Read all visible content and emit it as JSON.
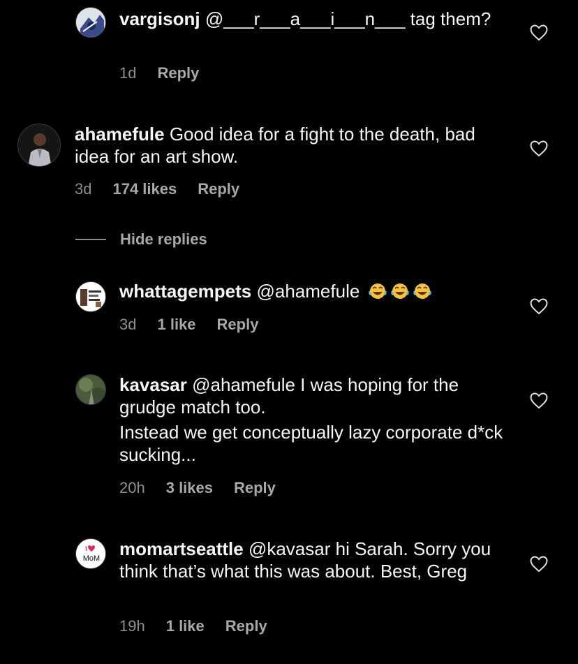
{
  "comments": [
    {
      "username": "vargisonj",
      "text": " @___r___a___i___n___ tag them?",
      "time": "1d",
      "likes": "",
      "reply_label": "Reply",
      "avatar_icon": "photo-avatar"
    },
    {
      "username": "ahamefule",
      "text": " Good idea for a fight to the death, bad idea for an art show.",
      "time": "3d",
      "likes": "174 likes",
      "reply_label": "Reply",
      "avatar_icon": "photo-avatar"
    },
    {
      "username": "whattagempets",
      "text": " @ahamefule ",
      "time": "3d",
      "likes": "1 like",
      "reply_label": "Reply",
      "avatar_icon": "logo-avatar",
      "emoji": [
        "tears-of-joy-emoji",
        "tears-of-joy-emoji",
        "tears-of-joy-emoji"
      ]
    },
    {
      "username": "kavasar",
      "text": " @ahamefule I was hoping for the grudge match too.",
      "text2": "Instead we get conceptually lazy corporate d*ck sucking...",
      "time": "20h",
      "likes": "3 likes",
      "reply_label": "Reply",
      "avatar_icon": "photo-avatar"
    },
    {
      "username": "momartseattle",
      "text": " @kavasar hi Sarah. Sorry you think that’s what this was about. Best, Greg",
      "time": "19h",
      "likes": "1 like",
      "reply_label": "Reply",
      "avatar_icon": "logo-avatar",
      "avatar_text": "MoM"
    }
  ],
  "hide_replies_label": "Hide replies",
  "colors": {
    "background": "#000000",
    "text": "#f5f5f5",
    "secondary": "#8e8e8e"
  }
}
